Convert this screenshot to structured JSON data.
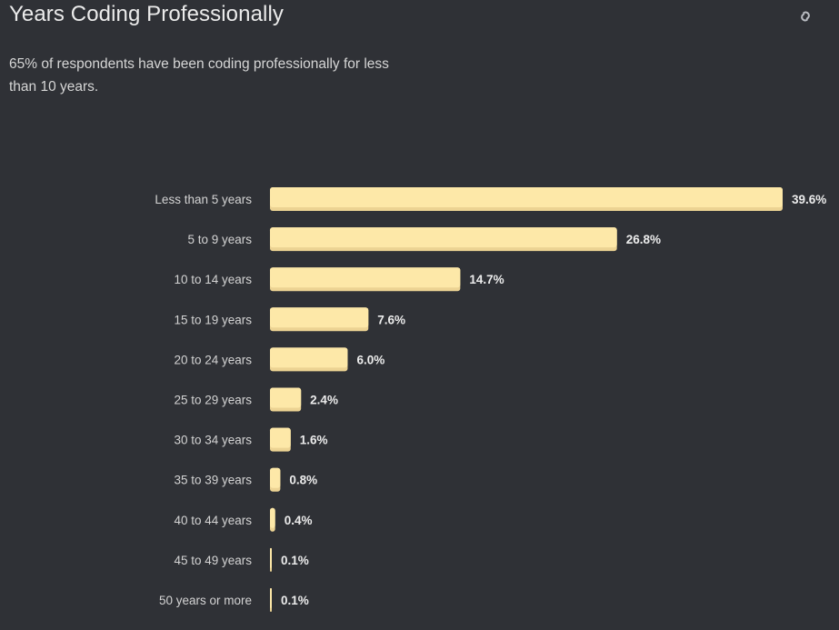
{
  "header": {
    "title": "Years Coding Professionally",
    "subtitle": "65% of respondents have been coding professionally for less than 10 years.",
    "link_icon": "link-icon"
  },
  "colors": {
    "background": "#2f3136",
    "bar": "#fde8a8",
    "bar_shadow": "#ecd393",
    "text": "#d4d4d4",
    "value_text": "#ececec"
  },
  "chart_data": {
    "type": "bar",
    "orientation": "horizontal",
    "title": "Years Coding Professionally",
    "subtitle": "65% of respondents have been coding professionally for less than 10 years.",
    "xlabel": "",
    "ylabel": "",
    "unit": "%",
    "grid": false,
    "legend": "none",
    "xlim": [
      0,
      39.6
    ],
    "categories": [
      "Less than 5 years",
      "5 to 9 years",
      "10 to 14 years",
      "15 to 19 years",
      "20 to 24 years",
      "25 to 29 years",
      "30 to 34 years",
      "35 to 39 years",
      "40 to 44 years",
      "45 to 49 years",
      "50 years or more"
    ],
    "values": [
      39.6,
      26.8,
      14.7,
      7.6,
      6.0,
      2.4,
      1.6,
      0.8,
      0.4,
      0.1,
      0.1
    ],
    "value_labels": [
      "39.6%",
      "26.8%",
      "14.7%",
      "7.6%",
      "6.0%",
      "2.4%",
      "1.6%",
      "0.8%",
      "0.4%",
      "0.1%",
      "0.1%"
    ]
  }
}
